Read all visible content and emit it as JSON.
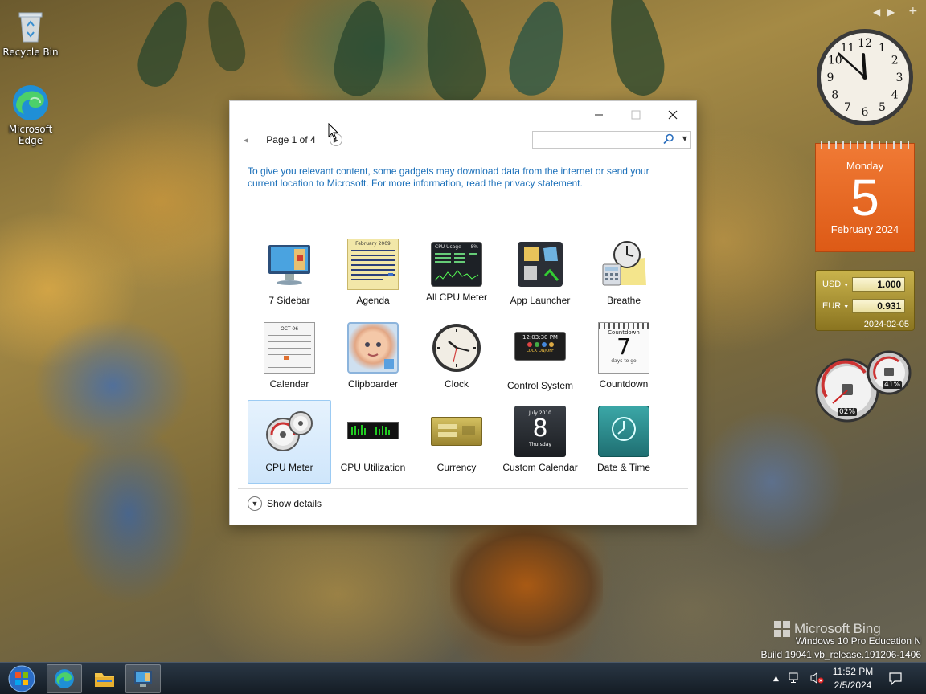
{
  "desktop": {
    "icons": [
      {
        "label": "Recycle Bin"
      },
      {
        "label": "Microsoft Edge"
      }
    ]
  },
  "gadget_window": {
    "page_label": "Page 1 of 4",
    "search_placeholder": "",
    "notice": "To give you relevant content, some gadgets may download data from the internet or send your current location to Microsoft. For more information, read the privacy statement.",
    "gadgets": [
      {
        "label": "7 Sidebar",
        "icon": "monitor-icon"
      },
      {
        "label": "Agenda",
        "icon": "agenda-icon"
      },
      {
        "label": "All CPU Meter",
        "icon": "cpu-usage-icon"
      },
      {
        "label": "App Launcher",
        "icon": "app-launcher-icon"
      },
      {
        "label": "Breathe",
        "icon": "breathe-icon"
      },
      {
        "label": "Calendar",
        "icon": "calendar-icon"
      },
      {
        "label": "Clipboarder",
        "icon": "clipboarder-icon"
      },
      {
        "label": "Clock",
        "icon": "clock-icon"
      },
      {
        "label": "Control System",
        "icon": "control-system-icon"
      },
      {
        "label": "Countdown",
        "icon": "countdown-icon"
      },
      {
        "label": "CPU Meter",
        "icon": "cpu-meter-icon",
        "selected": true
      },
      {
        "label": "CPU Utilization",
        "icon": "cpu-utilization-icon"
      },
      {
        "label": "Currency",
        "icon": "currency-icon"
      },
      {
        "label": "Custom Calendar",
        "icon": "custom-calendar-icon"
      },
      {
        "label": "Date & Time",
        "icon": "date-time-icon"
      }
    ],
    "thumb_text": {
      "agenda_month": "February 2009",
      "cpu_title": "CPU Usage",
      "cpu_pct": "8%",
      "control_time": "12:03:30 PM",
      "control_lock": "LOCK ON/OFF",
      "countdown_title": "Countdown",
      "countdown_num": "7",
      "countdown_sub": "days to go",
      "customcal_month": "July 2010",
      "customcal_num": "8",
      "customcal_day": "Thursday",
      "calendar_month": "OCT 06"
    },
    "show_details": "Show details"
  },
  "sidebar": {
    "clock": {
      "hour": 11,
      "minute": 52,
      "numerals": [
        "12",
        "1",
        "2",
        "3",
        "4",
        "5",
        "6",
        "7",
        "8",
        "9",
        "10",
        "11"
      ]
    },
    "calendar": {
      "weekday": "Monday",
      "day": "5",
      "month": "February 2024"
    },
    "currency": {
      "from_code": "USD",
      "from_value": "1.000",
      "to_code": "EUR",
      "to_value": "0.931",
      "date": "2024-02-05"
    },
    "meter": {
      "cpu": "02%",
      "ram": "41%"
    }
  },
  "watermark": {
    "bing": "Microsoft Bing",
    "edition": "Windows 10 Pro Education N",
    "build": "Build 19041.vb_release.191206-1406"
  },
  "taskbar": {
    "time": "11:52 PM",
    "date": "2/5/2024"
  }
}
